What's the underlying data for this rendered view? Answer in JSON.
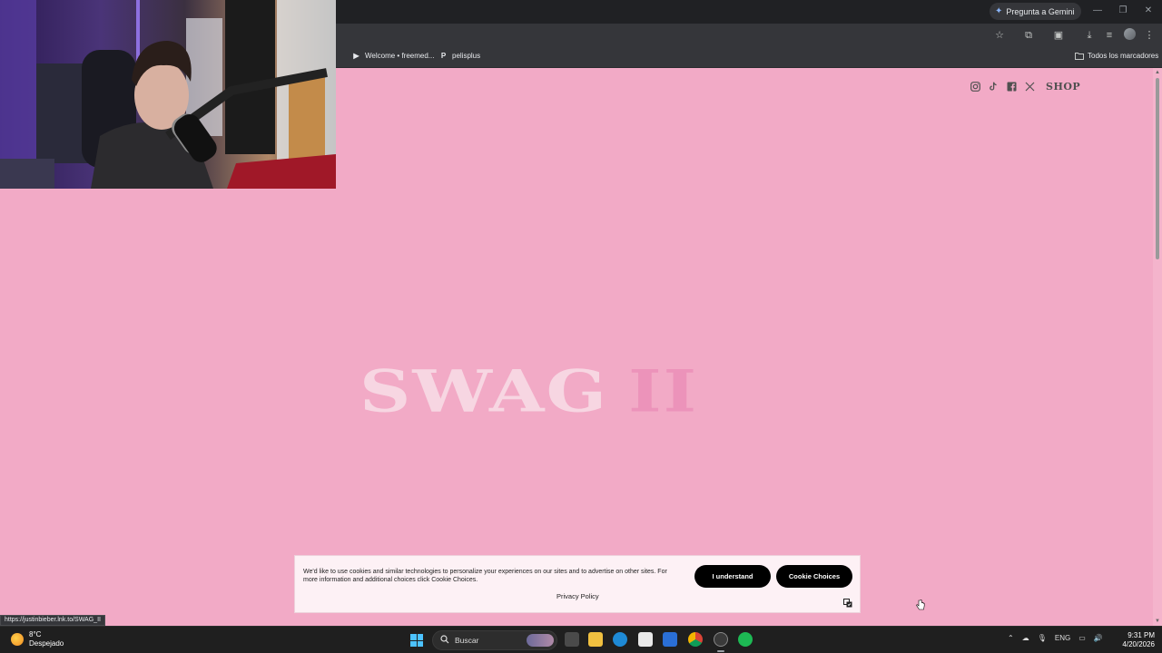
{
  "browser": {
    "gemini_label": "Pregunta a Gemini",
    "bookmarks": [
      {
        "label": "Welcome • freemed..."
      },
      {
        "label": "pelisplus"
      }
    ],
    "all_bookmarks_label": "Todos los marcadores",
    "status_url": "https://justinbieber.lnk.to/SWAG_II"
  },
  "page": {
    "background_color": "#f2aac6",
    "shop_label": "SHOP",
    "social_icons": [
      "instagram-icon",
      "tiktok-icon",
      "facebook-icon",
      "x-icon"
    ],
    "logo_main": "SWAG",
    "logo_numeral": "II"
  },
  "cookie_banner": {
    "text": "We'd like to use cookies and similar technologies to personalize your experiences on our sites and to advertise on other sites. For more information and additional choices click Cookie Choices.",
    "privacy_label": "Privacy Policy",
    "understand_label": "I understand",
    "choices_label": "Cookie Choices"
  },
  "taskbar": {
    "weather_temp": "8°C",
    "weather_desc": "Despejado",
    "search_placeholder": "Buscar",
    "language": "ENG",
    "time": "9:31 PM",
    "date": "4/20/2026"
  }
}
